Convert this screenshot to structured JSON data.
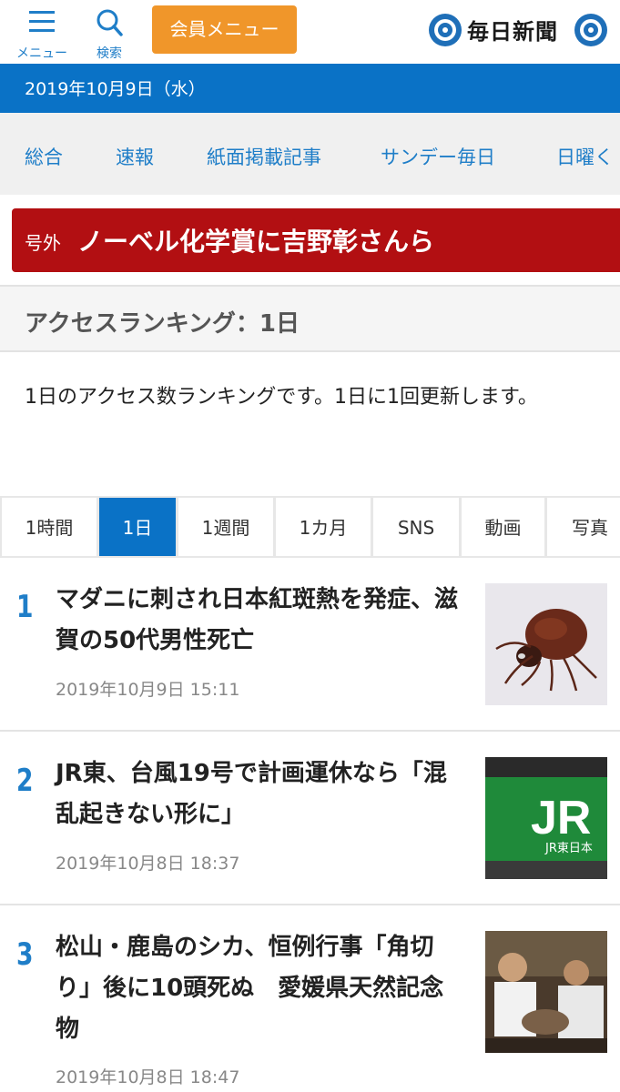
{
  "header": {
    "menu_label": "メニュー",
    "search_label": "検索",
    "member_menu_label": "会員メニュー",
    "logo_text": "毎日新聞",
    "accent_color": "#0a72c6",
    "member_color": "#f0962a"
  },
  "date_bar": {
    "text": "2019年10月9日（水）"
  },
  "categories": [
    "総合",
    "速報",
    "紙面掲載記事",
    "サンデー毎日",
    "日曜く"
  ],
  "extra": {
    "tag": "号外",
    "headline": "ノーベル化学賞に吉野彰さんら",
    "color": "#b20f12"
  },
  "ranking": {
    "heading": "アクセスランキング：1日",
    "description": "1日のアクセス数ランキングです。1日に1回更新します。"
  },
  "tabs": [
    "1時間",
    "1日",
    "1週間",
    "1カ月",
    "SNS",
    "動画",
    "写真"
  ],
  "active_tab": "1日",
  "articles": [
    {
      "rank": "1",
      "title": "マダニに刺され日本紅斑熱を発症、滋賀の50代男性死亡",
      "date": "2019年10月9日 15:11",
      "image": "tick-photo"
    },
    {
      "rank": "2",
      "title": "JR東、台風19号で計画運休なら「混乱起きない形に」",
      "date": "2019年10月8日 18:37",
      "image": "jr-east-sign-photo",
      "image_text": "JR東日本"
    },
    {
      "rank": "3",
      "title": "松山・鹿島のシカ、恒例行事「角切り」後に10頭死ぬ　愛媛県天然記念物",
      "date": "2019年10月8日 18:47",
      "image": "deer-ceremony-photo"
    }
  ]
}
